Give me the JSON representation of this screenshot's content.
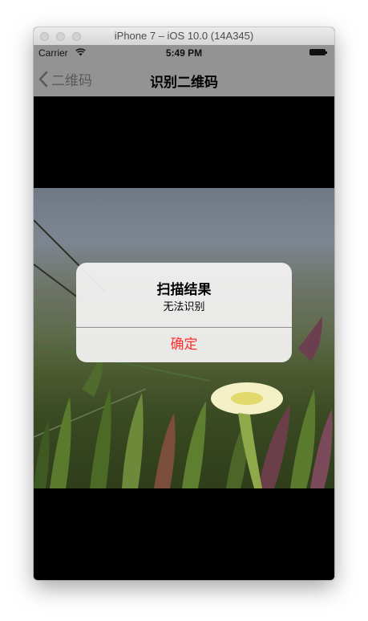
{
  "window": {
    "title": "iPhone 7 – iOS 10.0 (14A345)"
  },
  "status_bar": {
    "carrier": "Carrier",
    "time": "5:49 PM"
  },
  "nav_bar": {
    "back_label": "二维码",
    "title": "识别二维码"
  },
  "alert": {
    "title": "扫描结果",
    "message": "无法识别",
    "button_label": "确定",
    "button_color": "#ff2d2d"
  },
  "colors": {
    "nav_background": "#939393",
    "screen_background": "#000000"
  }
}
